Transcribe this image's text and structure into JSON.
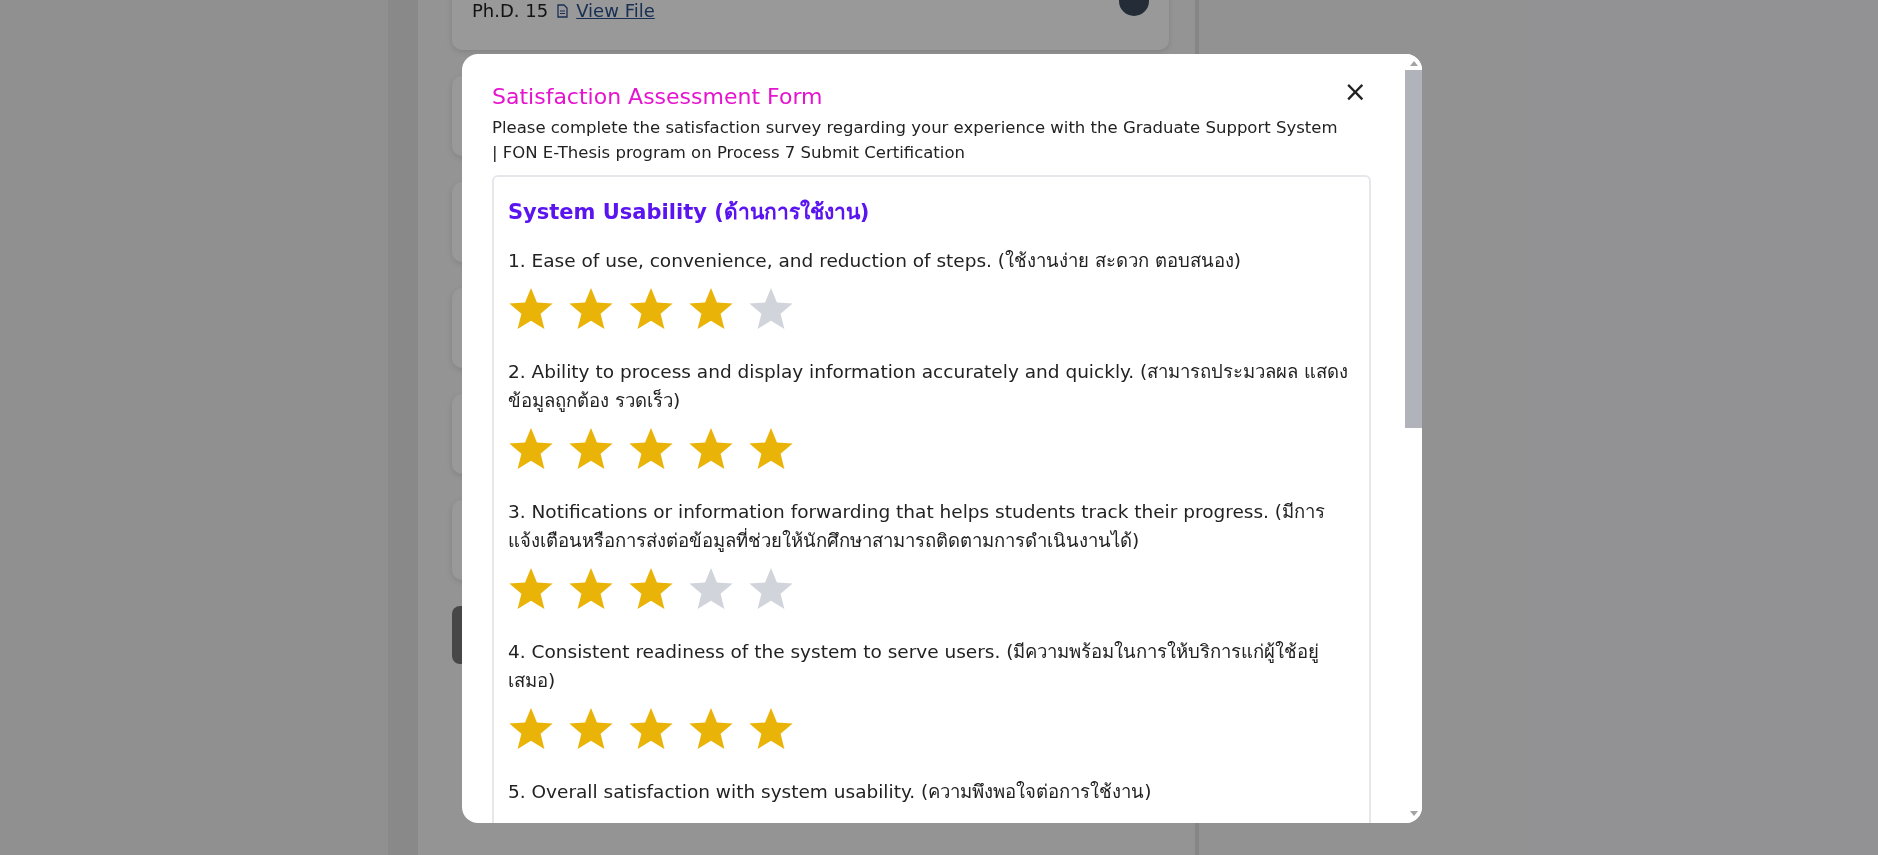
{
  "background": {
    "degree": "Ph.D. 15",
    "link": "View File"
  },
  "modal": {
    "title": "Satisfaction Assessment Form",
    "close": "×",
    "description": "Please complete the satisfaction survey regarding your experience with the Graduate Support System | FON E-Thesis program on Process 7 Submit Certification",
    "section": {
      "title": "System Usability (ด้านการใช้งาน)",
      "questions": [
        {
          "text": "1. Ease of use, convenience, and reduction of steps. (ใช้งานง่าย สะดวก ตอบสนอง)",
          "stars": 4
        },
        {
          "text": "2. Ability to process and display information accurately and quickly. (สามารถประมวลผล แสดงข้อมูลถูกต้อง รวดเร็ว)",
          "stars": 5
        },
        {
          "text": "3. Notifications or information forwarding that helps students track their progress. (มีการแจ้งเตือนหรือการส่งต่อข้อมูลที่ช่วยให้นักศึกษาสามารถติดตามการดำเนินงานได้)",
          "stars": 3
        },
        {
          "text": "4. Consistent readiness of the system to serve users. (มีความพร้อมในการให้บริการแก่ผู้ใช้อยู่เสมอ)",
          "stars": 5
        },
        {
          "text": "5. Overall satisfaction with system usability. (ความพึงพอใจต่อการใช้งาน)"
        }
      ]
    }
  }
}
